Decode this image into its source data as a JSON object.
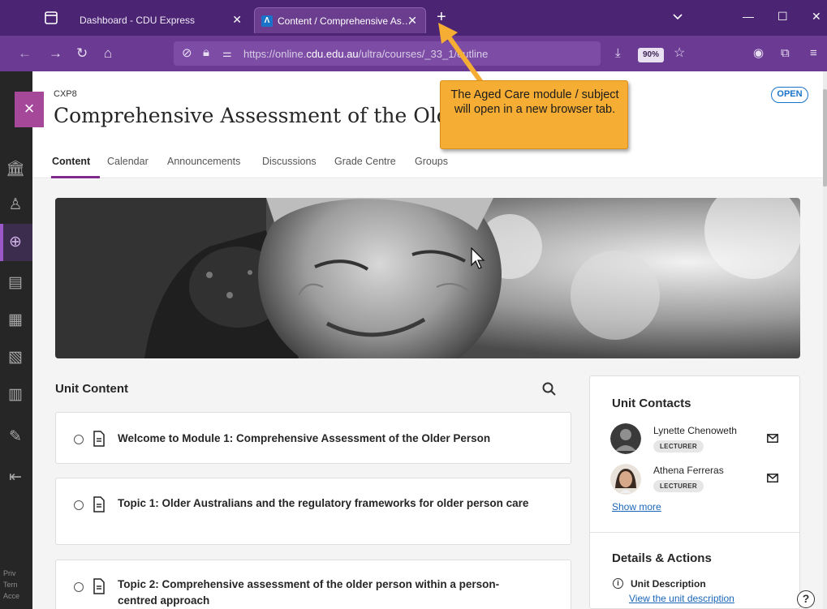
{
  "browser": {
    "tabs": [
      {
        "title": "Dashboard - CDU Express",
        "active": false
      },
      {
        "title": "Content / Comprehensive Assessment of the Older Person",
        "active": true
      }
    ],
    "url_prefix": "https://online.",
    "url_host": "cdu.edu.au",
    "url_path": "/ultra/courses/_",
    "url_tail": "33_1/outline",
    "zoom": "90%"
  },
  "course": {
    "id": "CXP8",
    "title": "Comprehensive Assessment of the Older Person",
    "status": "OPEN",
    "tabs": [
      "Content",
      "Calendar",
      "Announcements",
      "Discussions",
      "Grade Centre",
      "Groups"
    ],
    "active_tab": "Content"
  },
  "unit_content": {
    "heading": "Unit Content",
    "items": [
      {
        "title": "Welcome to Module 1: Comprehensive Assessment of the Older Person"
      },
      {
        "title": "Topic 1: Older Australians and the regulatory frameworks for older person care"
      },
      {
        "title": "Topic 2: Comprehensive assessment of the older person within a person-centred approach"
      }
    ]
  },
  "side_panel": {
    "contacts_heading": "Unit Contacts",
    "contacts": [
      {
        "name": "Lynette Chenoweth",
        "role": "LECTURER"
      },
      {
        "name": "Athena Ferreras",
        "role": "LECTURER"
      }
    ],
    "show_more": "Show more",
    "details_heading": "Details & Actions",
    "unit_description_label": "Unit Description",
    "unit_description_link": "View the unit description"
  },
  "leftnav": {
    "footer": [
      "Priv",
      "Tern",
      "Acce"
    ]
  },
  "annotation": {
    "callout_text": "The Aged Care module / subject will open in a new browser tab."
  },
  "colors": {
    "browser_frame": "#4b2573",
    "toolbar": "#6b3b94",
    "nav_accent": "#a5489a",
    "link": "#1a66b8",
    "callout": "#f5ad34"
  }
}
